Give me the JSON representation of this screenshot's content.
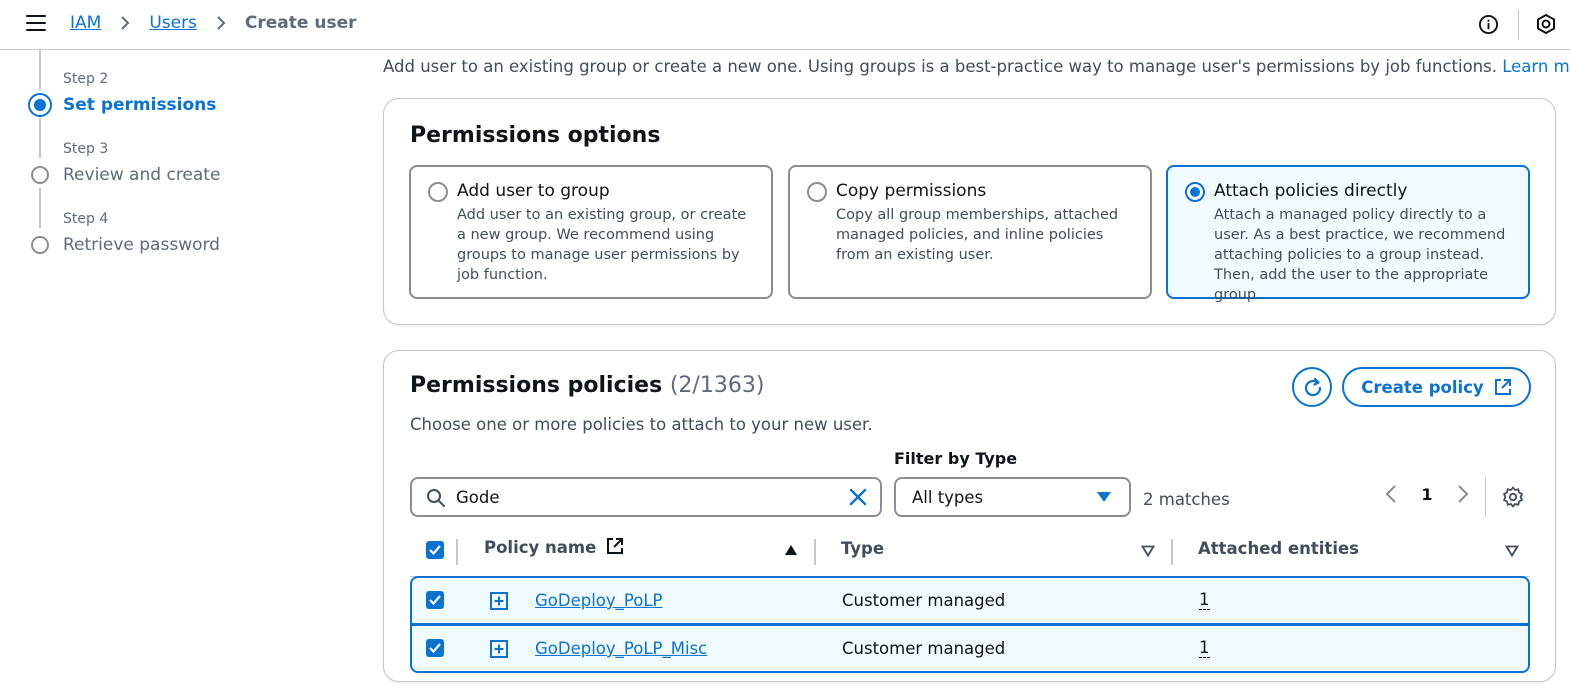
{
  "breadcrumb": {
    "items": [
      "IAM",
      "Users"
    ],
    "current": "Create user"
  },
  "steps": [
    {
      "label": "Step 2",
      "title": "Set permissions",
      "state": "active"
    },
    {
      "label": "Step 3",
      "title": "Review and create",
      "state": "pending"
    },
    {
      "label": "Step 4",
      "title": "Retrieve password",
      "state": "pending"
    }
  ],
  "intro": {
    "text": "Add user to an existing group or create a new one. Using groups is a best-practice way to manage user's permissions by job functions.",
    "learn_more": "Learn more"
  },
  "permissions_options": {
    "title": "Permissions options",
    "tiles": [
      {
        "title": "Add user to group",
        "description": "Add user to an existing group, or create a new group. We recommend using groups to manage user permissions by job function.",
        "selected": false
      },
      {
        "title": "Copy permissions",
        "description": "Copy all group memberships, attached managed policies, and inline policies from an existing user.",
        "selected": false
      },
      {
        "title": "Attach policies directly",
        "description": "Attach a managed policy directly to a user. As a best practice, we recommend attaching policies to a group instead. Then, add the user to the appropriate group.",
        "selected": true
      }
    ]
  },
  "policies": {
    "title": "Permissions policies",
    "count": "(2/1363)",
    "description": "Choose one or more policies to attach to your new user.",
    "create_policy_label": "Create policy",
    "filter_label": "Filter by Type",
    "search_value": "Gode",
    "filter_value": "All types",
    "matches": "2 matches",
    "page": "1",
    "columns": {
      "name": "Policy name",
      "type": "Type",
      "entities": "Attached entities"
    },
    "rows": [
      {
        "name": "GoDeploy_PoLP",
        "type": "Customer managed",
        "entities": "1",
        "checked": true
      },
      {
        "name": "GoDeploy_PoLP_Misc",
        "type": "Customer managed",
        "entities": "1",
        "checked": true
      }
    ]
  },
  "colors": {
    "accent": "#0972d3",
    "selected_bg": "#f0fbff",
    "border": "#8c8c94"
  }
}
